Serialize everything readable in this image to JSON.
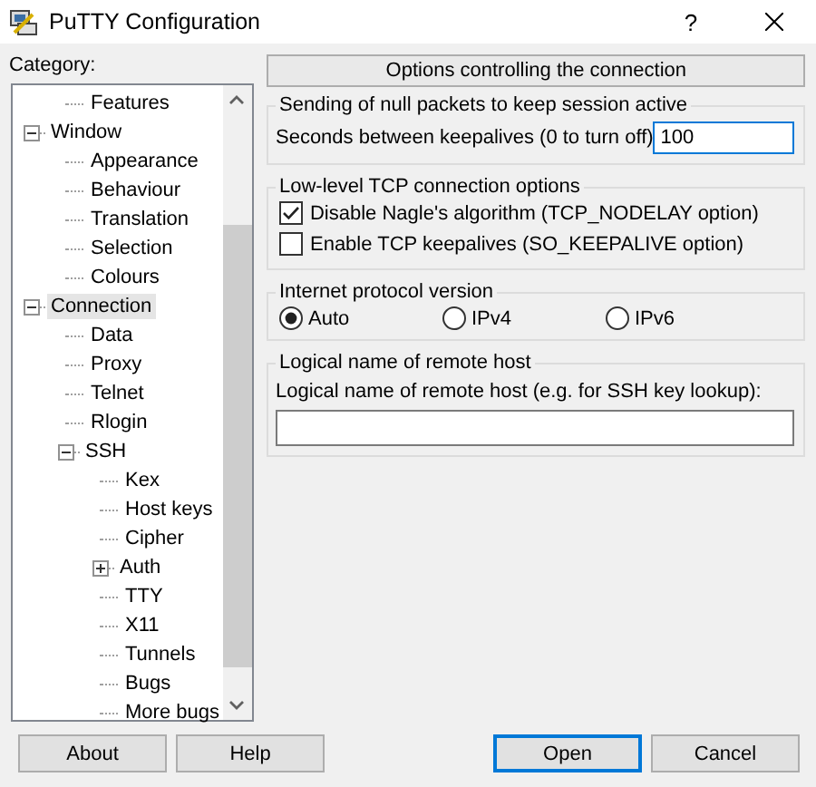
{
  "window": {
    "title": "PuTTY Configuration",
    "help_button": "?"
  },
  "category_label": "Category:",
  "tree": {
    "partial_branch": [
      {
        "label": "Features",
        "selected": false
      }
    ],
    "items": [
      {
        "label": "Window",
        "selected": false,
        "expanded": true,
        "children": [
          {
            "label": "Appearance",
            "selected": false
          },
          {
            "label": "Behaviour",
            "selected": false
          },
          {
            "label": "Translation",
            "selected": false
          },
          {
            "label": "Selection",
            "selected": false
          },
          {
            "label": "Colours",
            "selected": false
          }
        ]
      },
      {
        "label": "Connection",
        "selected": true,
        "expanded": true,
        "children": [
          {
            "label": "Data",
            "selected": false
          },
          {
            "label": "Proxy",
            "selected": false
          },
          {
            "label": "Telnet",
            "selected": false
          },
          {
            "label": "Rlogin",
            "selected": false
          },
          {
            "label": "SSH",
            "selected": false,
            "expanded": true,
            "children": [
              {
                "label": "Kex",
                "selected": false
              },
              {
                "label": "Host keys",
                "selected": false
              },
              {
                "label": "Cipher",
                "selected": false
              },
              {
                "label": "Auth",
                "selected": false,
                "expanded": false
              },
              {
                "label": "TTY",
                "selected": false
              },
              {
                "label": "X11",
                "selected": false
              },
              {
                "label": "Tunnels",
                "selected": false
              },
              {
                "label": "Bugs",
                "selected": false
              },
              {
                "label": "More bugs",
                "selected": false
              }
            ]
          }
        ]
      }
    ]
  },
  "panel": {
    "header": "Options controlling the connection",
    "keepalive_group": {
      "legend": "Sending of null packets to keep session active",
      "label": "Seconds between keepalives (0 to turn off)",
      "value": "100"
    },
    "tcp_group": {
      "legend": "Low-level TCP connection options",
      "checkboxes": [
        {
          "label": "Disable Nagle's algorithm (TCP_NODELAY option)",
          "checked": true
        },
        {
          "label": "Enable TCP keepalives (SO_KEEPALIVE option)",
          "checked": false
        }
      ]
    },
    "ip_group": {
      "legend": "Internet protocol version",
      "options": [
        {
          "label": "Auto",
          "selected": true
        },
        {
          "label": "IPv4",
          "selected": false
        },
        {
          "label": "IPv6",
          "selected": false
        }
      ]
    },
    "host_group": {
      "legend": "Logical name of remote host",
      "label": "Logical name of remote host (e.g. for SSH key lookup):"
    }
  },
  "buttons": [
    {
      "label": "About",
      "default": false
    },
    {
      "label": "Help",
      "default": false
    },
    {
      "label": "Open",
      "default": true
    },
    {
      "label": "Cancel",
      "default": false
    }
  ]
}
